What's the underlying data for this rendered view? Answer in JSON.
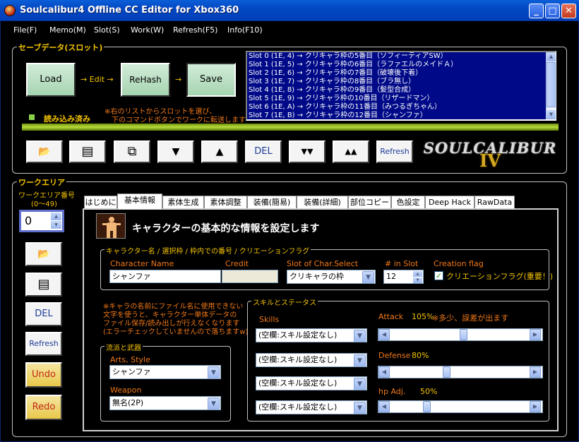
{
  "window": {
    "title": "Soulcalibur4 Offline CC Editor for Xbox360",
    "minimize": "_",
    "maximize": "□",
    "close": "✕"
  },
  "menu": [
    "File(F)",
    "Memo(M)",
    "Slot(S)",
    "Work(W)",
    "Refresh(F5)",
    "Info(F10)"
  ],
  "save_group": {
    "label": "セーブデータ(スロット)",
    "load": "Load",
    "edit_arrow": "→ Edit →",
    "rehash": "ReHash",
    "arrow": "→",
    "save": "Save",
    "status": "読み込み済み",
    "hint_line1": "※右のリストからスロットを選び、",
    "hint_line2": "下のコマンドボタンでワークに転送します",
    "slots": [
      "Slot  0  (1E, 4) → クリキャラ枠の5番目（ソフィーティアSW）",
      "Slot  1  (1E, 5) → クリキャラ枠の6番目（ラファエルのメイドＡ）",
      "Slot  2  (1E, 6) → クリキャラ枠の7番目（破壊後下着）",
      "Slot  3  (1E, 7) → クリキャラ枠の8番目（ブラ無し）",
      "Slot  4  (1E, 8) → クリキャラ枠の9番目（髪型合成）",
      "Slot  5  (1E, 9) → クリキャラ枠の10番目（リザードマン）",
      "Slot  6  (1E, A) → クリキャラ枠の11番目（みつるぎちゃん）",
      "Slot  7  (1E, B) → クリキャラ枠の12番目（シャンファ）"
    ],
    "toolbar": {
      "open_icon": "📂",
      "page_icon": "▤",
      "copy_icon": "⧉",
      "down": "▼",
      "up": "▲",
      "del": "DEL",
      "down2": "▼▼",
      "up2": "▲▲",
      "refresh": "Refresh"
    },
    "logo_main": "SOULCALIBUR",
    "logo_num": "IV"
  },
  "work_group": {
    "label": "ワークエリア",
    "area_label_line1": "ワークエリア番号",
    "area_label_line2": "(0～49)",
    "area_value": "0",
    "side": {
      "open_icon": "📂",
      "page_icon": "▤",
      "del": "DEL",
      "refresh": "Refresh",
      "undo": "Undo",
      "redo": "Redo"
    },
    "tabs": [
      "はじめに",
      "基本情報",
      "素体生成",
      "素体調整",
      "装備(簡易)",
      "装備(詳細)",
      "部位コピー",
      "色設定",
      "Deep Hack",
      "RawData"
    ],
    "active_tab": "基本情報",
    "heading": "キャラクターの基本的な情報を設定します",
    "basic": {
      "legend": "キャラクター名 / 選択枠 / 枠内での番号 / クリエーションフラグ",
      "name_label": "Character Name",
      "name_value": "シャンファ",
      "credit_label": "Credit",
      "credit_value": "",
      "slot_label": "Slot of Char.Select",
      "slot_value": "クリキャラの枠",
      "num_label": "# in Slot",
      "num_value": "12",
      "flag_label": "Creation flag",
      "flag_text": "クリエーションフラグ(重要！)",
      "flag_checked": "✓"
    },
    "warning": [
      "※キャラの名前にファイル名に使用できない",
      "文字を使うと、キャラクター単体データの",
      "ファイル保存/読み出しが行えなくなります",
      "(エラーチェックしていませんので落ちますw)"
    ],
    "style": {
      "legend": "流派と武器",
      "arts_label": "Arts, Style",
      "arts_value": "シャンファ",
      "weapon_label": "Weapon",
      "weapon_value": "無名(2P)"
    },
    "skills": {
      "legend": "スキルとステータス",
      "skills_label": "Skills",
      "items": [
        "(空欄:スキル設定なし)",
        "(空欄:スキル設定なし)",
        "(空欄:スキル設定なし)",
        "(空欄:スキル設定なし)"
      ],
      "attack_label": "Attack",
      "attack_value": "105%",
      "attack_note": "※多少、誤差が出ます",
      "attack_level": 105,
      "defense_label": "Defense",
      "defense_value": "80%",
      "defense_level": 80,
      "hp_label": "hp Adj.",
      "hp_value": "50%",
      "hp_level": 50
    }
  },
  "colors": {
    "accent": "#f5c400",
    "orange": "#f07818",
    "list_bg": "#000a88",
    "green": "#a6d4b0",
    "bar": "#9acd32"
  }
}
